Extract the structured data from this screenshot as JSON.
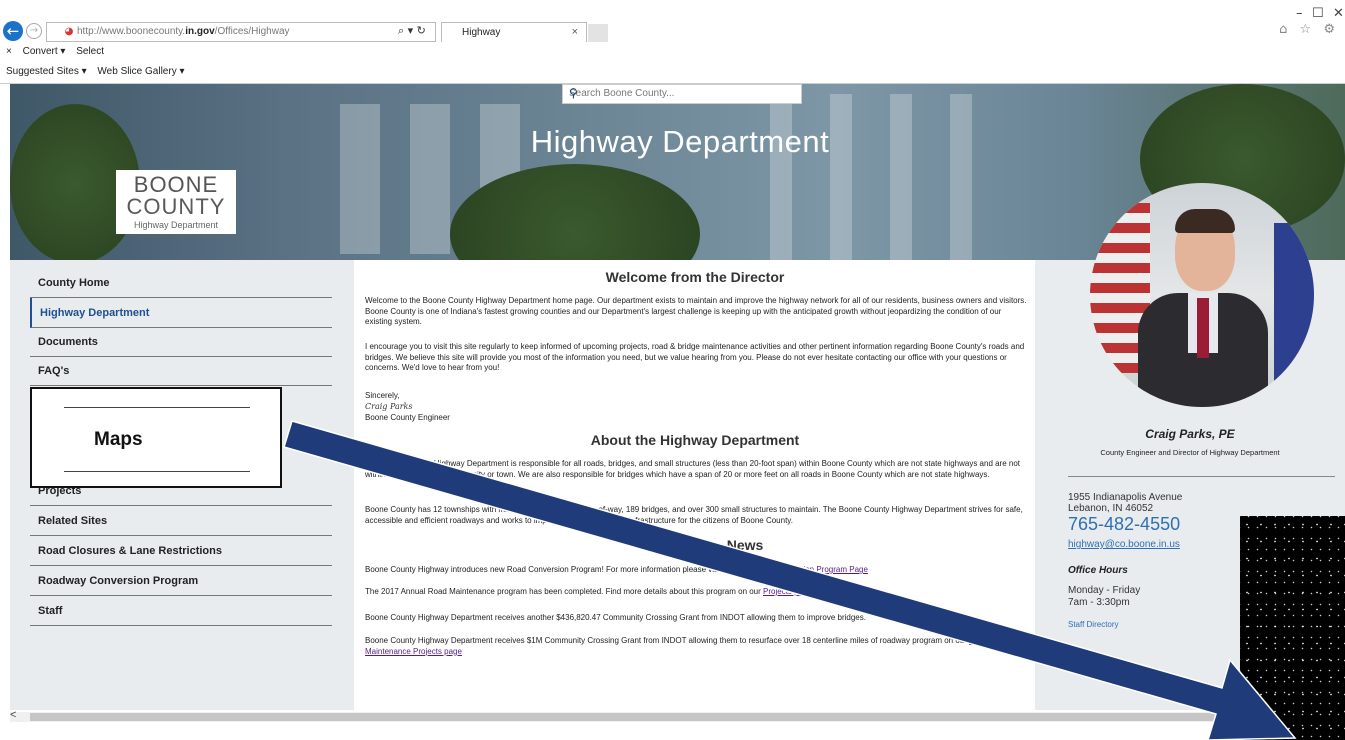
{
  "browser": {
    "url_prefix": "http://www.boonecounty.",
    "url_bold": "in.gov",
    "url_suffix": "/Offices/Highway",
    "search_glyph": "⌕ ▾ ↻",
    "tab_title": "Highway",
    "tab_close": "×",
    "window_controls": [
      "–",
      "☐",
      "✕"
    ],
    "right_icons": "⌂ ☆ ⚙",
    "row2": [
      "×",
      "Convert ▾",
      "Select"
    ],
    "row3": [
      "Suggested Sites ▾",
      "Web Slice Gallery ▾"
    ]
  },
  "header": {
    "search_placeholder": "Search Boone County...",
    "title": "Highway Department",
    "logo_line1": "BOONE",
    "logo_line2": "COUNTY",
    "logo_line3": "Highway Department"
  },
  "nav": {
    "items": [
      "County Home",
      "Highway Department",
      "Documents",
      "FAQ's",
      "Projects",
      "Related Sites",
      "Road Closures & Lane Restrictions",
      "Roadway Conversion Program",
      "Staff"
    ]
  },
  "main": {
    "welcome_heading": "Welcome from the Director",
    "p1": "Welcome to the Boone County Highway Department home page. Our department exists to maintain and improve the highway network for all of our residents, business owners and visitors. Boone County is one of Indiana's fastest growing counties and our Department's largest challenge is keeping up with the anticipated growth without jeopardizing the condition of our existing system.",
    "p2": "I encourage you to visit this site regularly to keep informed of upcoming projects, road & bridge maintenance activities and other pertinent information regarding Boone County's roads and bridges. We believe this site will provide you most of the information you need, but we value hearing from you. Please do not ever hesitate contacting our office with your questions or concerns. We'd love to hear from you!",
    "sincerely": "Sincerely,",
    "signature": "Craig Parks",
    "signer_title": "Boone County Engineer",
    "about_heading": "About the Highway Department",
    "about_p1": "The Boone County Highway Department is responsible for all roads, bridges, and small structures (less than 20-foot span) within Boone County which are not state highways and are not within the corporate limits of a city or town. We are also responsible for bridges which have a span of 20 or more feet on all roads in Boone County which are not state highways.",
    "about_p2": "Boone County has 12 townships with miles of roadway and rights-of-way, 189 bridges, and over 300 small structures to maintain. The Boone County Highway Department strives for safe, accessible and efficient roadways and works to improve the transportation infrastructure for the citizens of Boone County.",
    "news_heading": "News",
    "news1_text": "Boone County Highway introduces new Road Conversion Program! For more information please visit our ",
    "news1_link": "Roadway Conversion Program Page",
    "news2_text": "The 2017 Annual Road Maintenance program has been completed. Find more details about this program on our ",
    "news2_link": "Projects page",
    "news3_text": "Boone County Highway Department receives another $436,820.47 Community Crossing Grant from INDOT allowing them to improve bridges.",
    "news4_text": "Boone County Highway Department receives $1M Community Crossing Grant from INDOT allowing them to resurface over 18 centerline miles of roadway program on our ",
    "news4_link": "Road Maintenance Projects page"
  },
  "sidebar_right": {
    "name": "Craig Parks, PE",
    "title": "County Engineer and Director of Highway Department",
    "address1": "1955 Indianapolis Avenue",
    "address2": "Lebanon, IN 46052",
    "phone": "765-482-4550",
    "email": "highway@co.boone.in.us",
    "hours_heading": "Office Hours",
    "hours_days": "Monday - Friday",
    "hours_time": "7am - 3:30pm",
    "staff_link": "Staff Directory"
  },
  "overlay": {
    "maps_label": "Maps",
    "arrow_color": "#1f3b7a"
  },
  "scrollbar": {
    "left_arrow": "<"
  }
}
